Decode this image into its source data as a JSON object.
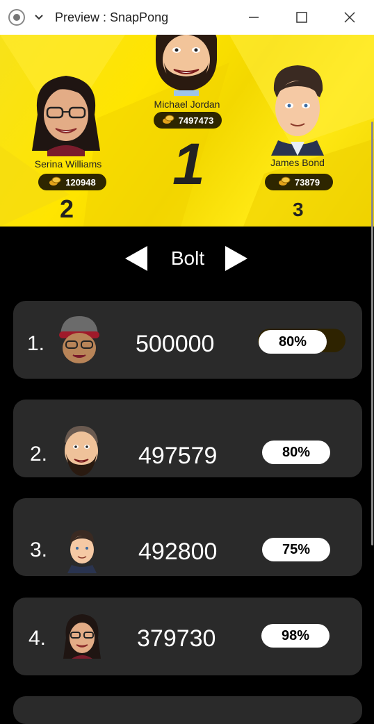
{
  "window": {
    "title": "Preview : SnapPong"
  },
  "podium": [
    {
      "place": "1",
      "name": "Michael Jordan",
      "coins": "7497473"
    },
    {
      "place": "2",
      "name": "Serina Williams",
      "coins": "120948"
    },
    {
      "place": "3",
      "name": "James Bond",
      "coins": "73879"
    }
  ],
  "selector": {
    "label": "Bolt"
  },
  "leaderboard": [
    {
      "rank": "1.",
      "score": "500000",
      "percent": "80%",
      "progress": 0.8
    },
    {
      "rank": "2.",
      "score": "497579",
      "percent": "80%",
      "progress": 0.8
    },
    {
      "rank": "3.",
      "score": "492800",
      "percent": "75%",
      "progress": 0.75
    },
    {
      "rank": "4.",
      "score": "379730",
      "percent": "98%",
      "progress": 0.98
    }
  ],
  "colors": {
    "podium_bg": "#ffe500",
    "card_bg": "#2a2a2a",
    "pill": "#ffffff",
    "page_bg": "#000000"
  },
  "icons": [
    "app-icon",
    "chevron-down-icon",
    "minimize-icon",
    "maximize-icon",
    "close-icon",
    "coins-icon",
    "arrow-left-icon",
    "arrow-right-icon"
  ]
}
